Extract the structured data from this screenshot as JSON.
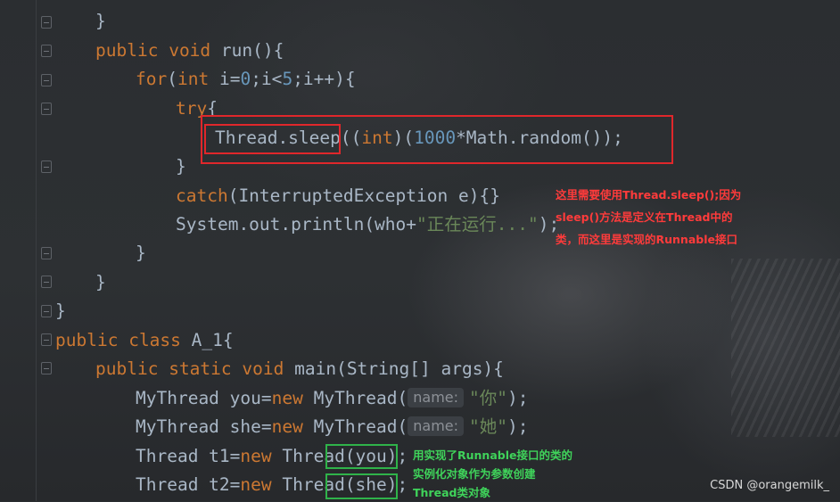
{
  "code_lines": {
    "l0": {
      "p1": "}"
    },
    "l1": {
      "k1": "public",
      "k2": "void",
      "t": " run(){"
    },
    "l2": {
      "k1": "for",
      "t1": "(",
      "k2": "int",
      "t2": " i=",
      "n1": "0",
      "t3": ";i<",
      "n2": "5",
      "t4": ";i++){"
    },
    "l3": {
      "k1": "try",
      "t": "{"
    },
    "l4": {
      "t1": "Thread.sleep(",
      "t2": "(",
      "k1": "int",
      "t3": ")(",
      "n1": "1000",
      "t4": "*Math.random());"
    },
    "l5": {
      "t": "}"
    },
    "l6": {
      "k1": "catch",
      "t": "(InterruptedException e){}"
    },
    "l7": {
      "t1": "System.out.println(who+",
      "s1": "\"正在运行...\"",
      "t2": ");"
    },
    "l8": {
      "t": "}"
    },
    "l9": {
      "t": "}"
    },
    "l10": {
      "t": "}"
    },
    "l11": {
      "k1": "public",
      "k2": "class",
      "t": " A_1{"
    },
    "l12": {
      "k1": "public",
      "k2": "static",
      "k3": "void",
      "t": " main(String[] args){"
    },
    "l13": {
      "t1": "MyThread you=",
      "k1": "new",
      "t2": " MyThread(",
      "hint": "name:",
      "s1": "\"你\"",
      "t3": ");"
    },
    "l14": {
      "t1": "MyThread she=",
      "k1": "new",
      "t2": " MyThread(",
      "hint": "name:",
      "s1": "\"她\"",
      "t3": ");"
    },
    "l15": {
      "t1": "Thread t1=",
      "k1": "new",
      "t2": " Thread(you);"
    },
    "l16": {
      "t1": "Thread t2=",
      "k1": "new",
      "t2": " Thread(she);"
    }
  },
  "annotations": {
    "red_note": "这里需要使用Thread.sleep();因为sleep()方法是定义在Thread中的类，而这里是实现的Runnable接口",
    "green_note": "用实现了Runnable接口的类的实例化对象作为参数创建Thread类对象"
  },
  "watermark": "CSDN @orangemilk_",
  "colors": {
    "keyword": "#cc7832",
    "number": "#6897bb",
    "string": "#6a8759",
    "text": "#a9b7c6",
    "red_box": "#e0272b",
    "green_box": "#2fb34a"
  }
}
